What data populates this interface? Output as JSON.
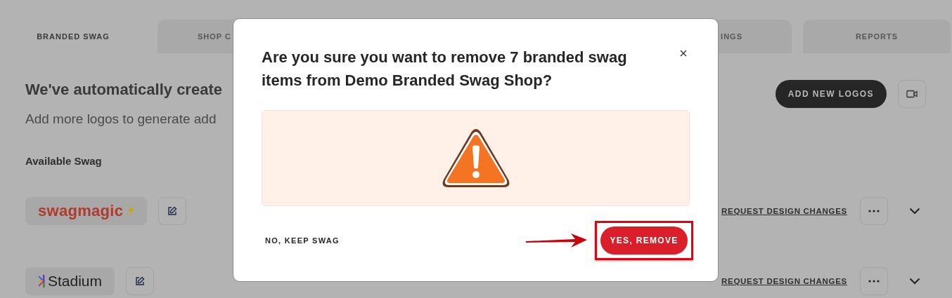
{
  "tabs": [
    {
      "label": "BRANDED SWAG",
      "selected": true
    },
    {
      "label": "SHOP C",
      "selected": false
    },
    {
      "label": "INGS",
      "selected": false
    },
    {
      "label": "REPORTS",
      "selected": false
    }
  ],
  "header": {
    "title": "We've automatically create",
    "subtitle": "Add more logos to generate add",
    "add_button": "ADD NEW LOGOS"
  },
  "section_title": "Available Swag",
  "swag_rows": [
    {
      "logo": "swagmagic",
      "kind": "swagmagic",
      "link": "REQUEST DESIGN CHANGES"
    },
    {
      "logo": "Stadium",
      "kind": "stadium",
      "link": "REQUEST DESIGN CHANGES"
    }
  ],
  "dialog": {
    "title": "Are you sure you want to remove 7 branded swag items from Demo Branded Swag Shop?",
    "cancel": "NO, KEEP SWAG",
    "confirm": "YES, REMOVE"
  }
}
